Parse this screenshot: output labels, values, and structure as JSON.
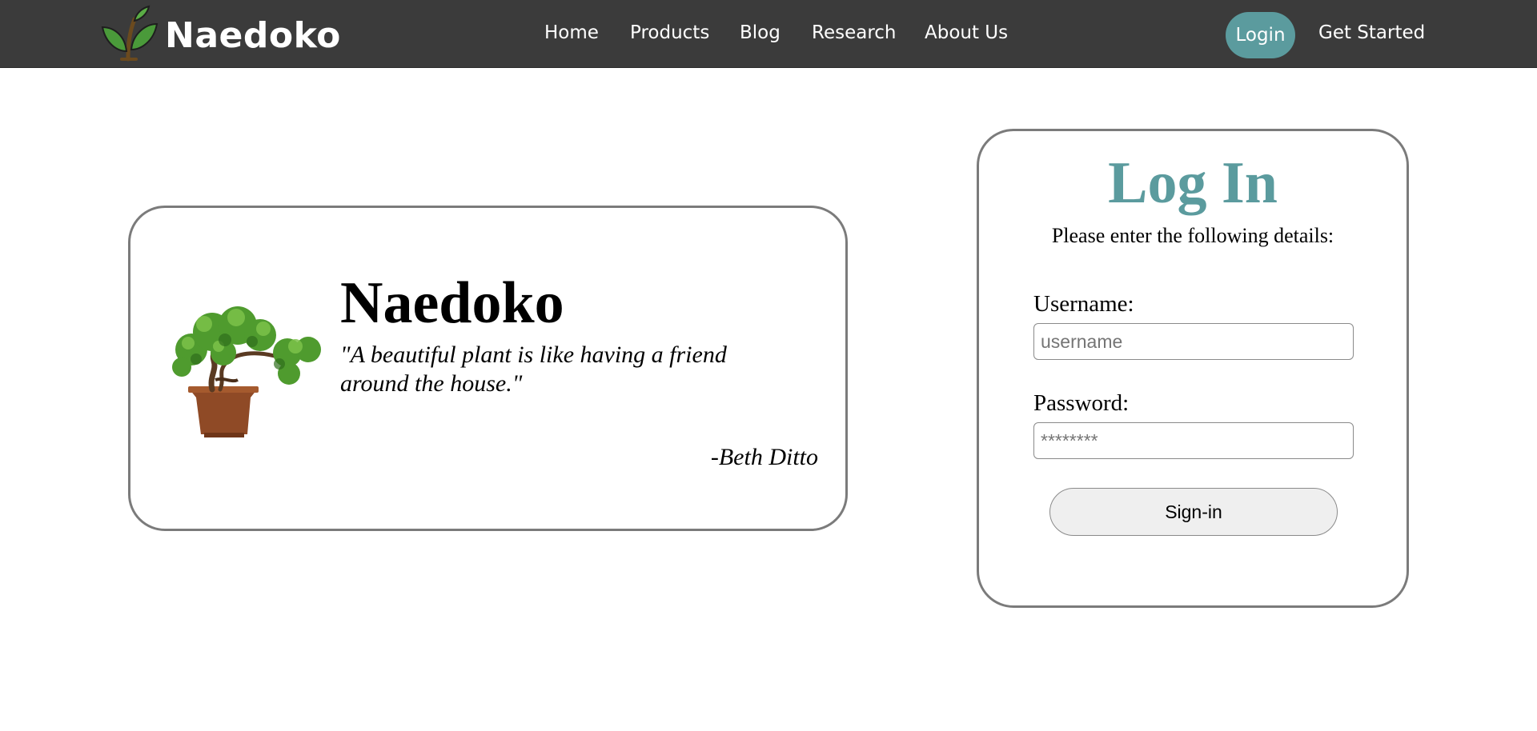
{
  "brand": {
    "name": "Naedoko",
    "logo_icon": "sprout-icon"
  },
  "nav": {
    "links": [
      {
        "label": "Home"
      },
      {
        "label": "Products"
      },
      {
        "label": "Blog"
      },
      {
        "label": "Research"
      },
      {
        "label": "About Us"
      }
    ],
    "login_label": "Login",
    "get_started_label": "Get Started"
  },
  "quote_card": {
    "title": "Naedoko",
    "quote": "\"A beautiful plant is like having a friend around the house.\"",
    "author": "-Beth Ditto",
    "image_icon": "bonsai-tree-image"
  },
  "login_form": {
    "title": "Log In",
    "subtitle": "Please enter the following details:",
    "username_label": "Username:",
    "username_placeholder": "username",
    "username_value": "",
    "password_label": "Password:",
    "password_placeholder": "********",
    "password_value": "",
    "submit_label": "Sign-in"
  },
  "colors": {
    "navbar_bg": "#3b3b3b",
    "accent_teal": "#5b9b9e",
    "card_border": "#7b7b7b",
    "button_bg": "#efefef"
  }
}
